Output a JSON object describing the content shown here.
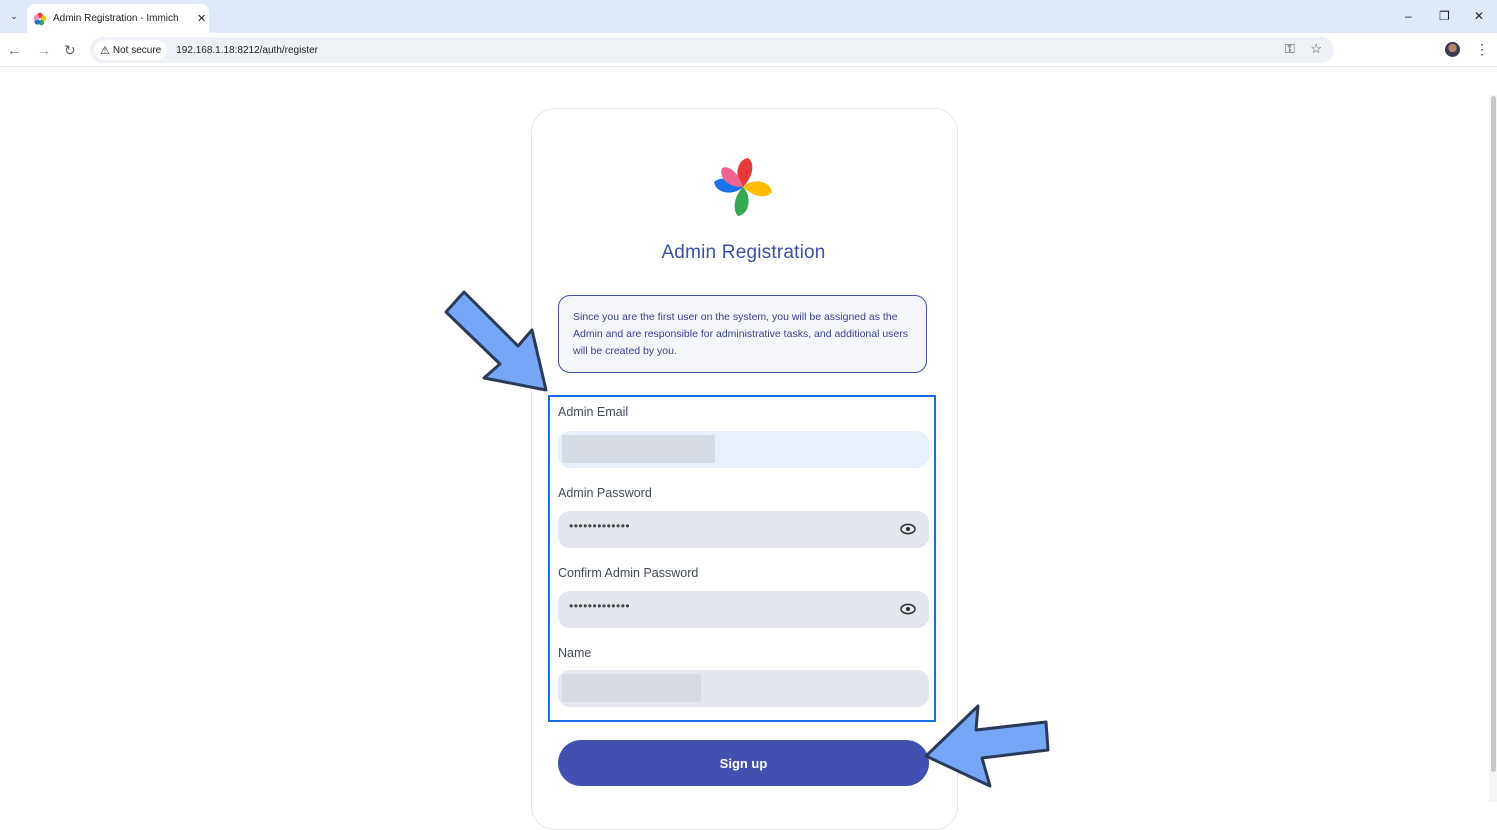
{
  "browser": {
    "tab_title": "Admin Registration - Immich",
    "security_chip": "Not secure",
    "url": "192.168.1.18:8212/auth/register"
  },
  "page": {
    "heading": "Admin Registration",
    "notice": "Since you are the first user on the system, you will be assigned as the Admin and are responsible for administrative tasks, and additional users will be created by you.",
    "fields": {
      "email_label": "Admin Email",
      "password_label": "Admin Password",
      "password_value": "•••••••••••••",
      "confirm_label": "Confirm Admin Password",
      "confirm_value": "•••••••••••••",
      "name_label": "Name"
    },
    "signup_label": "Sign up"
  },
  "icons": [
    "chevron-down-icon",
    "immich-logo-icon",
    "close-icon",
    "back-icon",
    "forward-icon",
    "reload-icon",
    "warning-icon",
    "key-icon",
    "star-icon",
    "minimize-icon",
    "restore-icon",
    "eye-icon",
    "kebab-menu-icon"
  ],
  "colors": {
    "accent": "#4250af",
    "highlight_border": "#1a6be8",
    "arrow_fill": "#76a6f5"
  }
}
